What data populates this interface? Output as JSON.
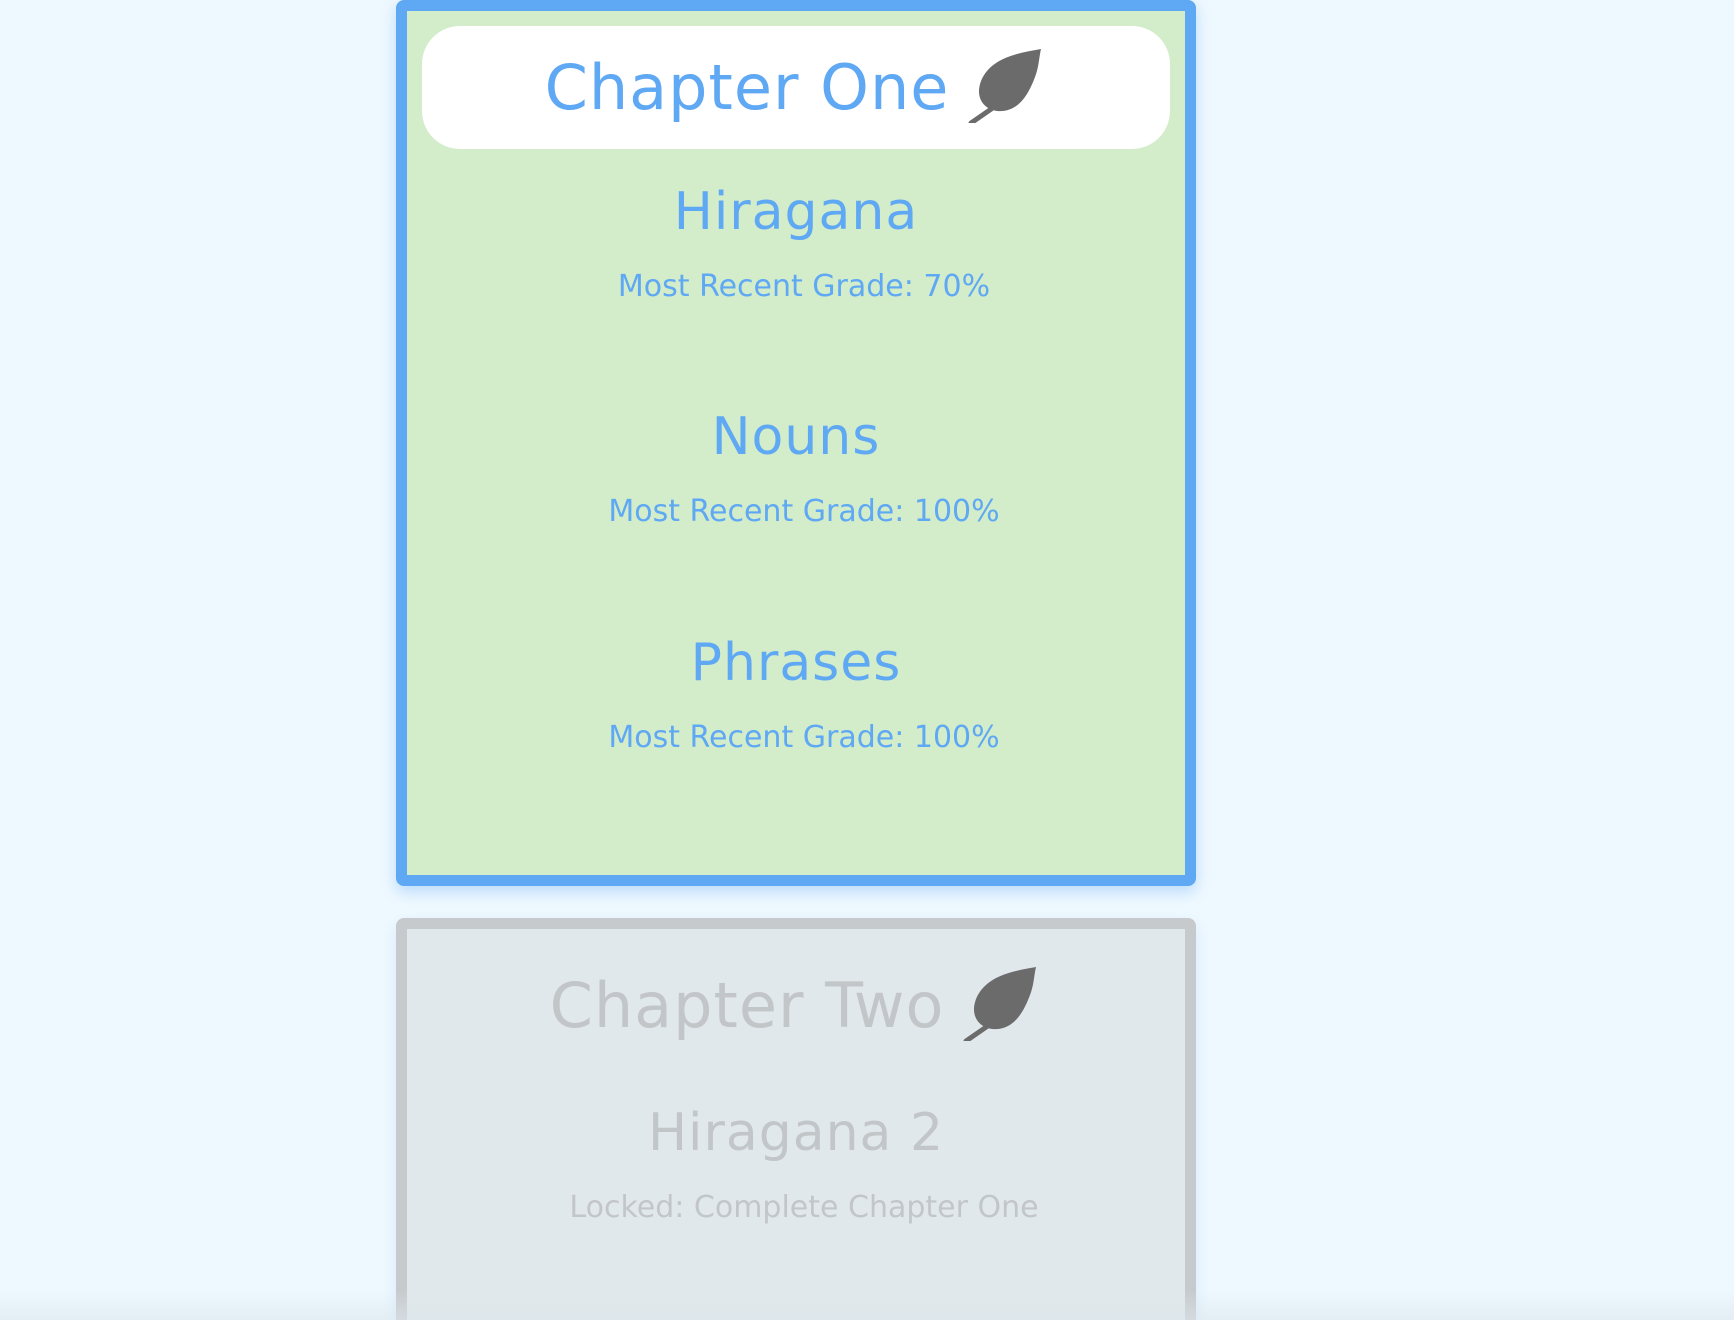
{
  "chapters": [
    {
      "title": "Chapter One",
      "icon": "leaf-icon",
      "status": "unlocked",
      "colors": {
        "accent": "#5fa8f4",
        "background": "#d3ecca",
        "header_bg": "#ffffff"
      },
      "lessons": [
        {
          "title": "Hiragana",
          "subtitle": "Most Recent Grade: 70%"
        },
        {
          "title": "Nouns",
          "subtitle": "Most Recent Grade: 100%"
        },
        {
          "title": "Phrases",
          "subtitle": "Most Recent Grade: 100%"
        }
      ]
    },
    {
      "title": "Chapter Two",
      "icon": "leaf-icon",
      "status": "locked",
      "colors": {
        "accent": "#c3c6c9",
        "background": "#e1e8eb",
        "border": "#c7cacd"
      },
      "lessons": [
        {
          "title": "Hiragana 2",
          "subtitle": "Locked: Complete Chapter One"
        }
      ]
    }
  ],
  "colors": {
    "page_background": "#eef8ff",
    "icon": "#6b6b6b"
  }
}
